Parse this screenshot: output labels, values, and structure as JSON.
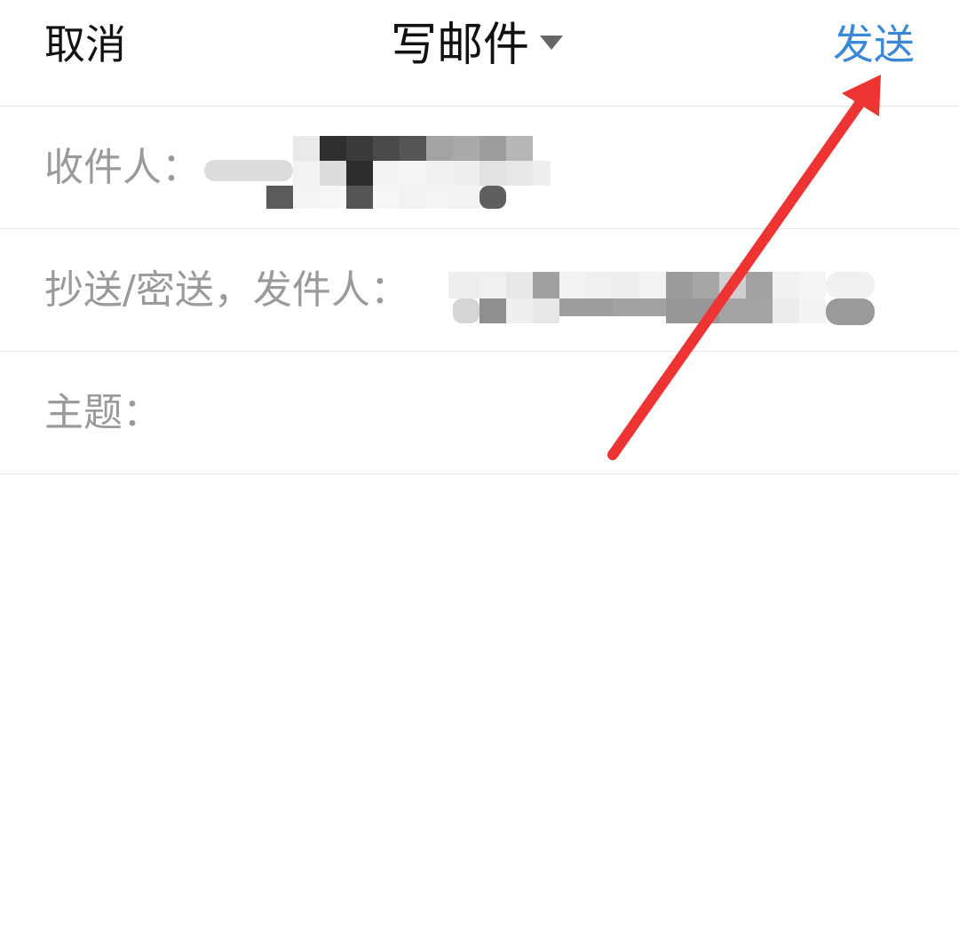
{
  "header": {
    "cancel_label": "取消",
    "title": "写邮件",
    "title_caret_icon": "caret-down-icon",
    "send_label": "发送",
    "send_color": "#3a88d6"
  },
  "fields": {
    "to_label": "收件人：",
    "cc_label": "抄送/密送，发件人：",
    "subject_label": "主题："
  },
  "annotation": {
    "arrow_color": "#ee3333",
    "arrow_icon": "arrow-icon"
  }
}
